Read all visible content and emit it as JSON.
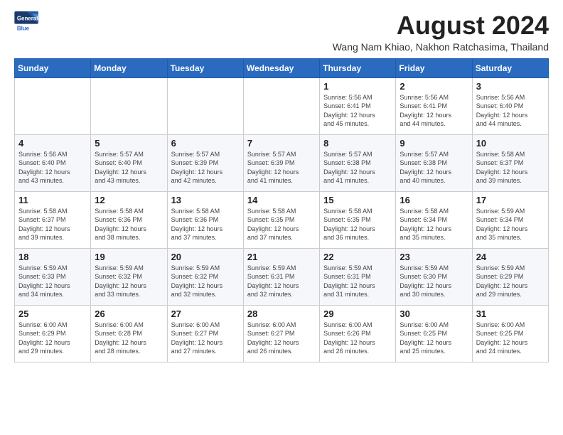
{
  "header": {
    "logo_line1": "General",
    "logo_line2": "Blue",
    "month_title": "August 2024",
    "location": "Wang Nam Khiao, Nakhon Ratchasima, Thailand"
  },
  "weekdays": [
    "Sunday",
    "Monday",
    "Tuesday",
    "Wednesday",
    "Thursday",
    "Friday",
    "Saturday"
  ],
  "weeks": [
    [
      {
        "day": "",
        "info": ""
      },
      {
        "day": "",
        "info": ""
      },
      {
        "day": "",
        "info": ""
      },
      {
        "day": "",
        "info": ""
      },
      {
        "day": "1",
        "info": "Sunrise: 5:56 AM\nSunset: 6:41 PM\nDaylight: 12 hours\nand 45 minutes."
      },
      {
        "day": "2",
        "info": "Sunrise: 5:56 AM\nSunset: 6:41 PM\nDaylight: 12 hours\nand 44 minutes."
      },
      {
        "day": "3",
        "info": "Sunrise: 5:56 AM\nSunset: 6:40 PM\nDaylight: 12 hours\nand 44 minutes."
      }
    ],
    [
      {
        "day": "4",
        "info": "Sunrise: 5:56 AM\nSunset: 6:40 PM\nDaylight: 12 hours\nand 43 minutes."
      },
      {
        "day": "5",
        "info": "Sunrise: 5:57 AM\nSunset: 6:40 PM\nDaylight: 12 hours\nand 43 minutes."
      },
      {
        "day": "6",
        "info": "Sunrise: 5:57 AM\nSunset: 6:39 PM\nDaylight: 12 hours\nand 42 minutes."
      },
      {
        "day": "7",
        "info": "Sunrise: 5:57 AM\nSunset: 6:39 PM\nDaylight: 12 hours\nand 41 minutes."
      },
      {
        "day": "8",
        "info": "Sunrise: 5:57 AM\nSunset: 6:38 PM\nDaylight: 12 hours\nand 41 minutes."
      },
      {
        "day": "9",
        "info": "Sunrise: 5:57 AM\nSunset: 6:38 PM\nDaylight: 12 hours\nand 40 minutes."
      },
      {
        "day": "10",
        "info": "Sunrise: 5:58 AM\nSunset: 6:37 PM\nDaylight: 12 hours\nand 39 minutes."
      }
    ],
    [
      {
        "day": "11",
        "info": "Sunrise: 5:58 AM\nSunset: 6:37 PM\nDaylight: 12 hours\nand 39 minutes."
      },
      {
        "day": "12",
        "info": "Sunrise: 5:58 AM\nSunset: 6:36 PM\nDaylight: 12 hours\nand 38 minutes."
      },
      {
        "day": "13",
        "info": "Sunrise: 5:58 AM\nSunset: 6:36 PM\nDaylight: 12 hours\nand 37 minutes."
      },
      {
        "day": "14",
        "info": "Sunrise: 5:58 AM\nSunset: 6:35 PM\nDaylight: 12 hours\nand 37 minutes."
      },
      {
        "day": "15",
        "info": "Sunrise: 5:58 AM\nSunset: 6:35 PM\nDaylight: 12 hours\nand 36 minutes."
      },
      {
        "day": "16",
        "info": "Sunrise: 5:58 AM\nSunset: 6:34 PM\nDaylight: 12 hours\nand 35 minutes."
      },
      {
        "day": "17",
        "info": "Sunrise: 5:59 AM\nSunset: 6:34 PM\nDaylight: 12 hours\nand 35 minutes."
      }
    ],
    [
      {
        "day": "18",
        "info": "Sunrise: 5:59 AM\nSunset: 6:33 PM\nDaylight: 12 hours\nand 34 minutes."
      },
      {
        "day": "19",
        "info": "Sunrise: 5:59 AM\nSunset: 6:32 PM\nDaylight: 12 hours\nand 33 minutes."
      },
      {
        "day": "20",
        "info": "Sunrise: 5:59 AM\nSunset: 6:32 PM\nDaylight: 12 hours\nand 32 minutes."
      },
      {
        "day": "21",
        "info": "Sunrise: 5:59 AM\nSunset: 6:31 PM\nDaylight: 12 hours\nand 32 minutes."
      },
      {
        "day": "22",
        "info": "Sunrise: 5:59 AM\nSunset: 6:31 PM\nDaylight: 12 hours\nand 31 minutes."
      },
      {
        "day": "23",
        "info": "Sunrise: 5:59 AM\nSunset: 6:30 PM\nDaylight: 12 hours\nand 30 minutes."
      },
      {
        "day": "24",
        "info": "Sunrise: 5:59 AM\nSunset: 6:29 PM\nDaylight: 12 hours\nand 29 minutes."
      }
    ],
    [
      {
        "day": "25",
        "info": "Sunrise: 6:00 AM\nSunset: 6:29 PM\nDaylight: 12 hours\nand 29 minutes."
      },
      {
        "day": "26",
        "info": "Sunrise: 6:00 AM\nSunset: 6:28 PM\nDaylight: 12 hours\nand 28 minutes."
      },
      {
        "day": "27",
        "info": "Sunrise: 6:00 AM\nSunset: 6:27 PM\nDaylight: 12 hours\nand 27 minutes."
      },
      {
        "day": "28",
        "info": "Sunrise: 6:00 AM\nSunset: 6:27 PM\nDaylight: 12 hours\nand 26 minutes."
      },
      {
        "day": "29",
        "info": "Sunrise: 6:00 AM\nSunset: 6:26 PM\nDaylight: 12 hours\nand 26 minutes."
      },
      {
        "day": "30",
        "info": "Sunrise: 6:00 AM\nSunset: 6:25 PM\nDaylight: 12 hours\nand 25 minutes."
      },
      {
        "day": "31",
        "info": "Sunrise: 6:00 AM\nSunset: 6:25 PM\nDaylight: 12 hours\nand 24 minutes."
      }
    ]
  ]
}
